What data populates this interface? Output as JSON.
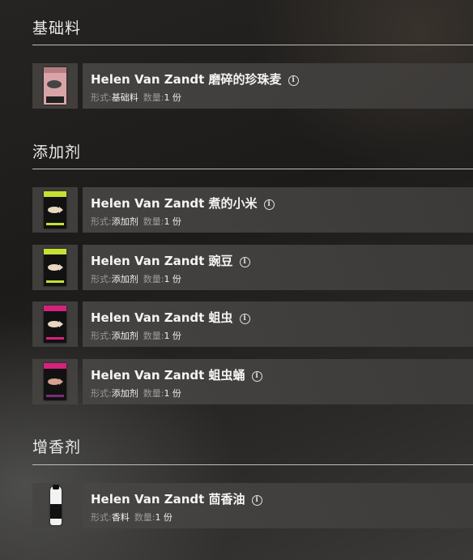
{
  "sections": [
    {
      "title": "基础料",
      "items": [
        {
          "name": "Helen Van Zandt 磨碎的珍珠麦",
          "type_label": "形式:",
          "type": "基础料",
          "qty_label": "数量:",
          "qty": "1 份",
          "icon": "pink-bait-bag-icon"
        }
      ]
    },
    {
      "title": "添加剂",
      "items": [
        {
          "name": "Helen Van Zandt 煮的小米",
          "type_label": "形式:",
          "type": "添加剂",
          "qty_label": "数量:",
          "qty": "1 份",
          "icon": "green-additive-bag-icon"
        },
        {
          "name": "Helen Van Zandt 豌豆",
          "type_label": "形式:",
          "type": "添加剂",
          "qty_label": "数量:",
          "qty": "1 份",
          "icon": "green-additive-bag-icon"
        },
        {
          "name": "Helen Van Zandt 蛆虫",
          "type_label": "形式:",
          "type": "添加剂",
          "qty_label": "数量:",
          "qty": "1 份",
          "icon": "magenta-additive-bag-icon"
        },
        {
          "name": "Helen Van Zandt 蛆虫蛹",
          "type_label": "形式:",
          "type": "添加剂",
          "qty_label": "数量:",
          "qty": "1 份",
          "icon": "magenta-additive-bag-icon"
        }
      ]
    },
    {
      "title": "增香剂",
      "items": [
        {
          "name": "Helen Van Zandt 茴香油",
          "type_label": "形式:",
          "type": "香料",
          "qty_label": "数量:",
          "qty": "1 份",
          "icon": "flavor-bottle-icon"
        }
      ]
    }
  ],
  "colors": {
    "green_band": "#c6e033",
    "magenta_band": "#d6217e",
    "pink_bag": "#d9a4a7",
    "text_muted": "#9a9a9a"
  }
}
